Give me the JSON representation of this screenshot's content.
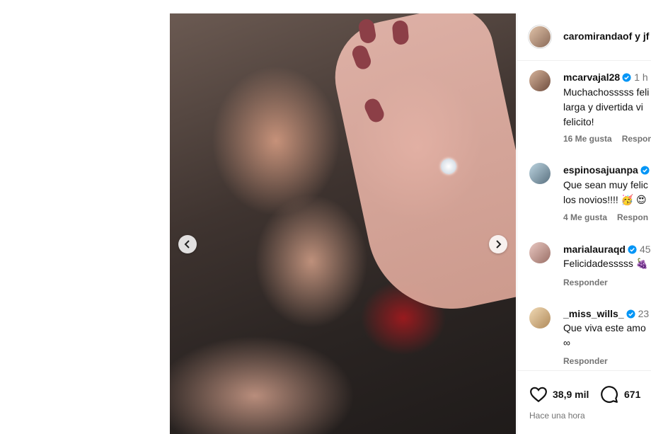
{
  "post": {
    "author": "caromirandaof",
    "coauthor_text": "y jf",
    "photo_alt": "",
    "nav": {
      "prev_icon": "chevron-left-icon",
      "next_icon": "chevron-right-icon"
    }
  },
  "comments": [
    {
      "user": "mcarvajal28",
      "verified": true,
      "time": "1 h",
      "text": "Muchachosssss feli\nlarga y divertida vi\nfelicito!",
      "likes": "16 Me gusta",
      "reply": "Respon"
    },
    {
      "user": "espinosajuanpa",
      "verified": true,
      "time": "",
      "text": "Que sean muy felic\nlos novios!!!! 🥳 😍",
      "likes": "4 Me gusta",
      "reply": "Respon"
    },
    {
      "user": "marialauraqd",
      "verified": true,
      "time": "45",
      "text": "Felicidadesssss 🍇",
      "likes": "",
      "reply": "Responder"
    },
    {
      "user": "_miss_wills_",
      "verified": true,
      "time": "23",
      "text": "Que viva este amo\n∞",
      "likes": "",
      "reply": "Responder"
    }
  ],
  "footer": {
    "likes_count": "38,9 mil",
    "comments_count": "671",
    "timestamp": "Hace una hora",
    "like_icon": "heart-icon",
    "comment_icon": "speech-bubble-icon"
  },
  "colors": {
    "verified": "#0095f6",
    "muted": "#737373",
    "border": "#efefef"
  }
}
